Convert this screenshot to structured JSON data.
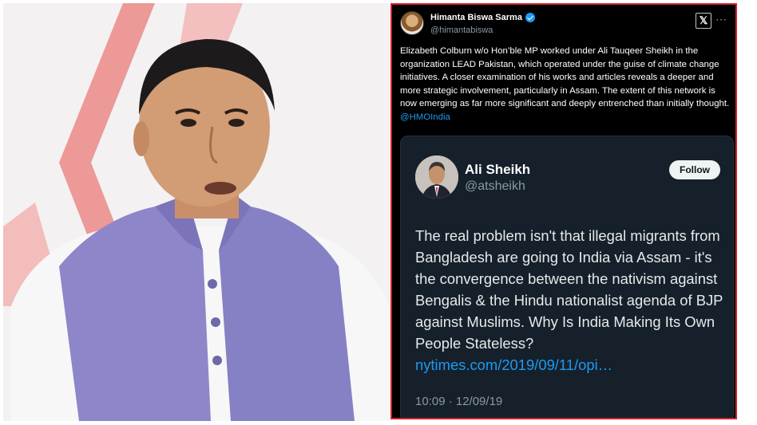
{
  "colors": {
    "frame": "#d0232a",
    "link": "#1d9bf0",
    "tweet_bg": "#000000",
    "quote_bg": "#15202b",
    "accent_graphic": "#ea8a87"
  },
  "tweet": {
    "author_name": "Himanta Biswa Sarma",
    "handle": "@himantabiswa",
    "body": "Elizabeth Colburn  w/o Hon’ble MP worked under Ali Tauqeer Sheikh in the organization LEAD Pakistan, which operated under the guise of climate change initiatives. A closer examination of his works and articles reveals a deeper and more strategic involvement, particularly in Assam. The extent of this network is now emerging as far more significant and deeply entrenched than initially thought.",
    "mention": "@HMOIndia",
    "icons": {
      "verified": "verified-badge-icon",
      "platform": "x-logo-icon",
      "more": "more-icon"
    }
  },
  "quoted": {
    "name": "Ali Sheikh",
    "handle": "@atsheikh",
    "follow_label": "Follow",
    "text": "The real problem isn't that illegal migrants from Bangladesh are going to India via Assam - it's the convergence between the nativism against Bengalis & the Hindu nationalist agenda of BJP against Muslims. Why Is India Making Its Own People Stateless?",
    "link": "nytimes.com/2019/09/11/opi…",
    "timestamp": "10:09 · 12/09/19"
  }
}
